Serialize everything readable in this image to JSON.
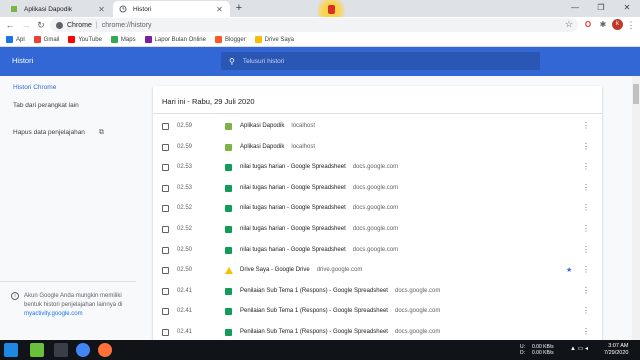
{
  "browser": {
    "tabs": [
      {
        "title": "Aplikasi Dapodik",
        "active": false
      },
      {
        "title": "Histori",
        "active": true
      }
    ],
    "omnibox": {
      "label": "Chrome",
      "url": "chrome://history"
    },
    "avatar_letter": "k",
    "bookmarks": [
      {
        "label": "Apl",
        "icon": "apps-grid-icon",
        "color": "#1a73e8"
      },
      {
        "label": "Gmail",
        "icon": "gmail-icon",
        "color": "#ea4335"
      },
      {
        "label": "YouTube",
        "icon": "youtube-icon",
        "color": "#ff0000"
      },
      {
        "label": "Maps",
        "icon": "maps-icon",
        "color": "#34a853"
      },
      {
        "label": "Lapor Bulan Online",
        "icon": "bookmark-icon",
        "color": "#7b1fa2"
      },
      {
        "label": "Blogger",
        "icon": "blogger-icon",
        "color": "#ff5722"
      },
      {
        "label": "Drive Saya",
        "icon": "drive-icon",
        "color": "#fbbc04"
      }
    ]
  },
  "history": {
    "title": "Histori",
    "search_placeholder": "Telusuri histori",
    "sidebar": {
      "items": [
        {
          "label": "Histori Chrome",
          "active": true
        },
        {
          "label": "Tab dari perangkat lain",
          "active": false
        },
        {
          "label": "Hapus data penjelajahan",
          "active": false
        }
      ],
      "footer_text": "Akun Google Anda mungkin memiliki bentuk histori penjelajahan lainnya di",
      "footer_link": "myactivity.google.com"
    },
    "date_heading": "Hari ini - Rabu, 29 Juli 2020",
    "entries": [
      {
        "time": "02.59",
        "title": "Aplikasi Dapodik",
        "domain": "localhost",
        "favicon": "dapodik",
        "starred": false
      },
      {
        "time": "02.59",
        "title": "Aplikasi Dapodik",
        "domain": "localhost",
        "favicon": "dapodik",
        "starred": false
      },
      {
        "time": "02.53",
        "title": "nilai tugas harian - Google Spreadsheet",
        "domain": "docs.google.com",
        "favicon": "sheet",
        "starred": false
      },
      {
        "time": "02.53",
        "title": "nilai tugas harian - Google Spreadsheet",
        "domain": "docs.google.com",
        "favicon": "sheet",
        "starred": false
      },
      {
        "time": "02.52",
        "title": "nilai tugas harian - Google Spreadsheet",
        "domain": "docs.google.com",
        "favicon": "sheet",
        "starred": false
      },
      {
        "time": "02.52",
        "title": "nilai tugas harian - Google Spreadsheet",
        "domain": "docs.google.com",
        "favicon": "sheet",
        "starred": false
      },
      {
        "time": "02.50",
        "title": "nilai tugas harian - Google Spreadsheet",
        "domain": "docs.google.com",
        "favicon": "sheet",
        "starred": false
      },
      {
        "time": "02.50",
        "title": "Drive Saya - Google Drive",
        "domain": "drive.google.com",
        "favicon": "drive",
        "starred": true
      },
      {
        "time": "02.41",
        "title": "Penilaian Sub Tema 1 (Respons) - Google Spreadsheet",
        "domain": "docs.google.com",
        "favicon": "sheet",
        "starred": false
      },
      {
        "time": "02.41",
        "title": "Penilaian Sub Tema 1 (Respons) - Google Spreadsheet",
        "domain": "docs.google.com",
        "favicon": "sheet",
        "starred": false
      },
      {
        "time": "02.41",
        "title": "Penilaian Sub Tema 1 (Respons) - Google Spreadsheet",
        "domain": "docs.google.com",
        "favicon": "sheet",
        "starred": false
      }
    ]
  },
  "taskbar": {
    "upload": "U:",
    "download": "D:",
    "up_speed": "0.00 KB/s",
    "down_speed": "0.00 KB/s",
    "time": "3:07 AM",
    "date": "7/29/2020"
  },
  "colors": {
    "header_blue": "#3367d6",
    "sheet_green": "#0f9d58",
    "star_blue": "#3367d6"
  }
}
